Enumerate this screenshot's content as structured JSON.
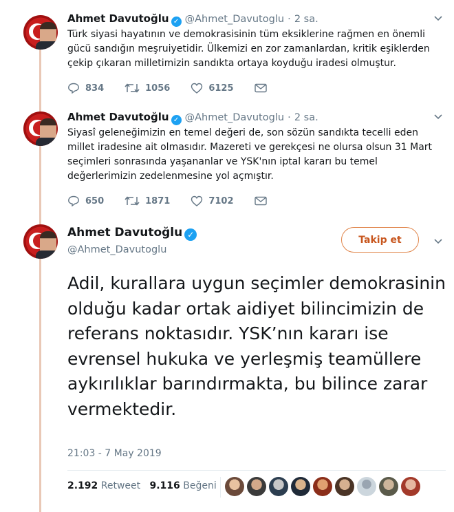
{
  "author": {
    "name": "Ahmet Davutoğlu",
    "handle": "@Ahmet_Davutoglu"
  },
  "thread": [
    {
      "time_ago": "2 sa.",
      "text": "Türk siyasi hayatının ve demokrasisinin tüm eksiklerine rağmen en önemli gücü sandığın meşruiyetidir. Ülkemizi en zor zamanlardan, kritik eşiklerden çekip çıkaran milletimizin sandıkta ortaya koyduğu iradesi olmuştur.",
      "replies": "834",
      "retweets": "1056",
      "likes": "6125"
    },
    {
      "time_ago": "2 sa.",
      "text": "Siyasî geleneğimizin en temel değeri de, son sözün sandıkta tecelli eden millet iradesine ait olmasıdır. Mazereti ve gerekçesi ne olursa olsun 31 Mart seçimleri sonrasında yaşananlar ve YSK'nın iptal kararı bu temel değerlerimizin zedelenmesine yol açmıştır.",
      "replies": "650",
      "retweets": "1871",
      "likes": "7102"
    }
  ],
  "main_tweet": {
    "follow_label": "Takip et",
    "text": "Adil, kurallara uygun seçimler demokrasinin olduğu kadar ortak aidiyet bilincimizin de referans noktasıdır. YSK’nın kararı ise evrensel hukuka ve yerleşmiş teamüllere aykırılıklar barındırmakta, bu bilince zarar vermektedir.",
    "timestamp": "21:03 - 7 May 2019",
    "retweet_count": "2.192",
    "retweet_label": "Retweet",
    "like_count": "9.116",
    "like_label": "Beğeni"
  },
  "icons": [
    "verified-icon",
    "reply-icon",
    "retweet-icon",
    "like-icon",
    "message-icon",
    "chevron-down-icon"
  ],
  "colors": {
    "accent": "#1da1f2",
    "follow": "#e0854a",
    "thread_line": "#e9c8b6"
  }
}
